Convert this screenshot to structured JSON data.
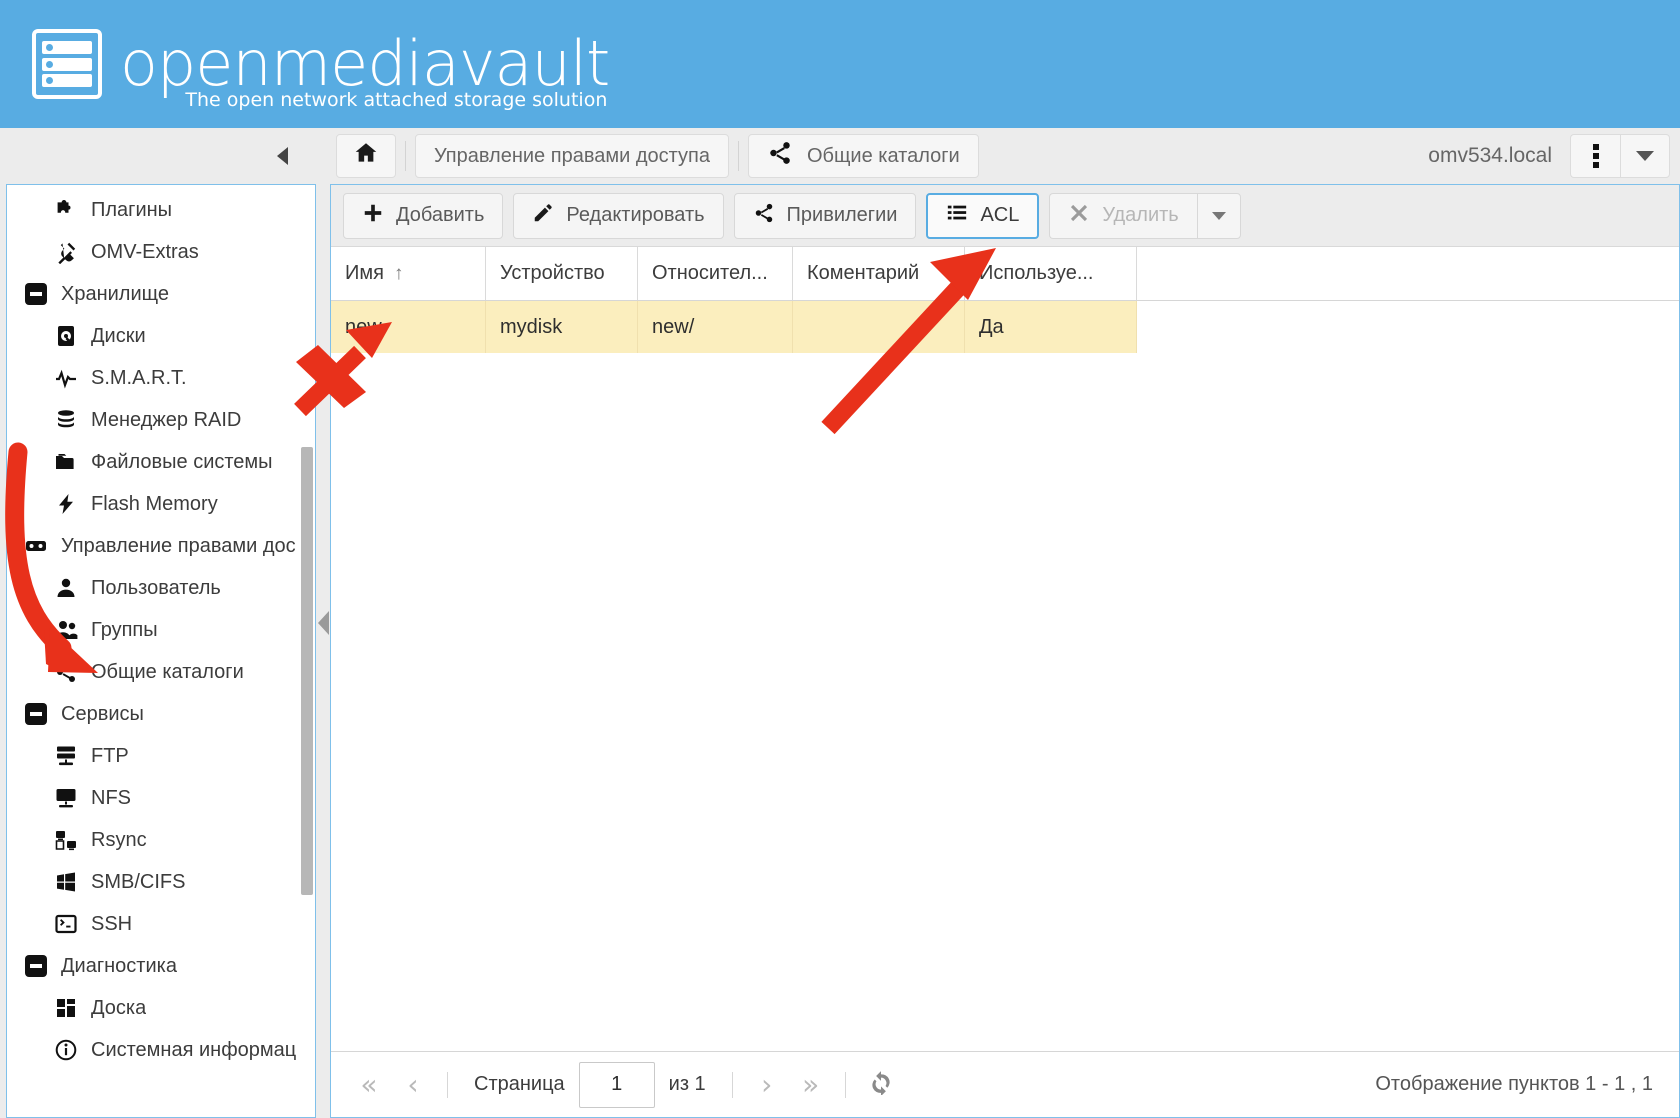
{
  "header": {
    "brand": "openmediavault",
    "tagline": "The open network attached storage solution",
    "logo_icon": "server-stack-icon"
  },
  "topbar": {
    "home_icon": "home-icon",
    "breadcrumb": [
      {
        "label": "Управление правами доступа",
        "icon": ""
      },
      {
        "label": "Общие каталоги",
        "icon": "share-icon"
      }
    ],
    "hostname": "omv534.local",
    "menu_icon": "kebab-menu-icon",
    "dropdown_icon": "chevron-down-icon",
    "collapse_icon": "collapse-left-icon"
  },
  "sidebar": {
    "items": [
      {
        "label": "Плагины",
        "icon": "puzzle-icon",
        "level": "child"
      },
      {
        "label": "OMV-Extras",
        "icon": "plug-icon",
        "level": "child"
      },
      {
        "label": "Хранилище",
        "icon": "group-collapse-icon",
        "level": "group"
      },
      {
        "label": "Диски",
        "icon": "harddisk-icon",
        "level": "child"
      },
      {
        "label": "S.M.A.R.T.",
        "icon": "pulse-icon",
        "level": "child"
      },
      {
        "label": "Менеджер RAID",
        "icon": "database-icon",
        "level": "child"
      },
      {
        "label": "Файловые системы",
        "icon": "folder-icon",
        "level": "child"
      },
      {
        "label": "Flash Memory",
        "icon": "bolt-icon",
        "level": "child"
      },
      {
        "label": "Управление правами дос",
        "icon": "key-icon",
        "level": "group"
      },
      {
        "label": "Пользователь",
        "icon": "user-icon",
        "level": "child"
      },
      {
        "label": "Группы",
        "icon": "users-icon",
        "level": "child"
      },
      {
        "label": "Общие каталоги",
        "icon": "share-icon",
        "level": "child"
      },
      {
        "label": "Сервисы",
        "icon": "group-collapse-icon",
        "level": "group"
      },
      {
        "label": "FTP",
        "icon": "server-icon",
        "level": "child"
      },
      {
        "label": "NFS",
        "icon": "monitor-icon",
        "level": "child"
      },
      {
        "label": "Rsync",
        "icon": "sync-devices-icon",
        "level": "child"
      },
      {
        "label": "SMB/CIFS",
        "icon": "windows-icon",
        "level": "child"
      },
      {
        "label": "SSH",
        "icon": "terminal-icon",
        "level": "child"
      },
      {
        "label": "Диагностика",
        "icon": "group-collapse-icon",
        "level": "group"
      },
      {
        "label": "Доска",
        "icon": "dashboard-icon",
        "level": "child"
      },
      {
        "label": "Системная информац",
        "icon": "info-icon",
        "level": "child"
      }
    ]
  },
  "toolbar": {
    "add_label": "Добавить",
    "add_icon": "plus-icon",
    "edit_label": "Редактировать",
    "edit_icon": "pencil-icon",
    "privileges_label": "Привилегии",
    "privileges_icon": "share-icon",
    "acl_label": "ACL",
    "acl_icon": "list-icon",
    "delete_label": "Удалить",
    "delete_icon": "close-x-icon",
    "delete_dropdown_icon": "caret-down-icon"
  },
  "grid": {
    "columns": [
      {
        "label": "Имя",
        "sort": "↑"
      },
      {
        "label": "Устройство",
        "sort": ""
      },
      {
        "label": "Относител...",
        "sort": ""
      },
      {
        "label": "Коментарий",
        "sort": ""
      },
      {
        "label": "Используе...",
        "sort": ""
      }
    ],
    "rows": [
      {
        "name": "new",
        "device": "mydisk",
        "relative": "new/",
        "comment": "",
        "used": "Да"
      }
    ]
  },
  "pager": {
    "first_icon": "«",
    "prev_icon": "‹",
    "page_label": "Страница",
    "page_value": "1",
    "of_label": "из 1",
    "next_icon": "›",
    "last_icon": "»",
    "refresh_icon": "refresh-icon",
    "status": "Отображение пунктов 1 - 1 , 1"
  },
  "colors": {
    "brand_blue": "#58ace2",
    "selected_row": "#fbeebe",
    "focus_border": "#58ace2",
    "annotation_red": "#e8311b"
  }
}
